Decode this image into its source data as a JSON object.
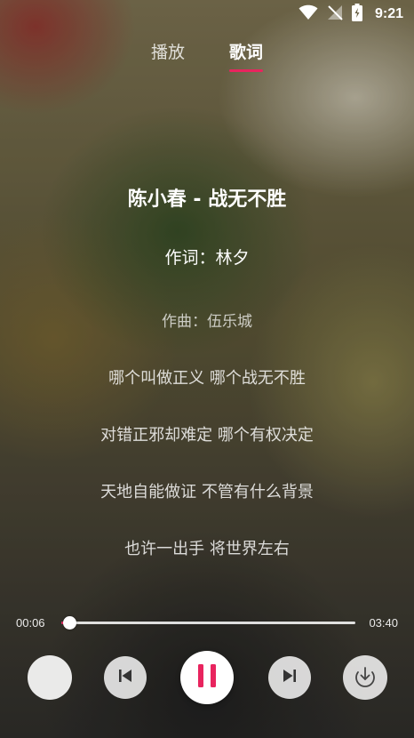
{
  "status_bar": {
    "time": "9:21"
  },
  "tabs": [
    {
      "label": "播放",
      "active": false
    },
    {
      "label": "歌词",
      "active": true
    }
  ],
  "lyrics": {
    "title": "陈小春 - 战无不胜",
    "lines": [
      "作词：林夕",
      "作曲：伍乐城",
      "哪个叫做正义 哪个战无不胜",
      "对错正邪却难定 哪个有权决定",
      "天地自能做证 不管有什么背景",
      "也许一出手 将世界左右"
    ]
  },
  "player": {
    "elapsed": "00:06",
    "duration": "03:40",
    "progress_fraction": 0.027
  },
  "colors": {
    "accent": "#e8245e"
  },
  "icons": [
    "album-cover",
    "previous-icon",
    "pause-icon",
    "next-icon",
    "download-icon"
  ]
}
